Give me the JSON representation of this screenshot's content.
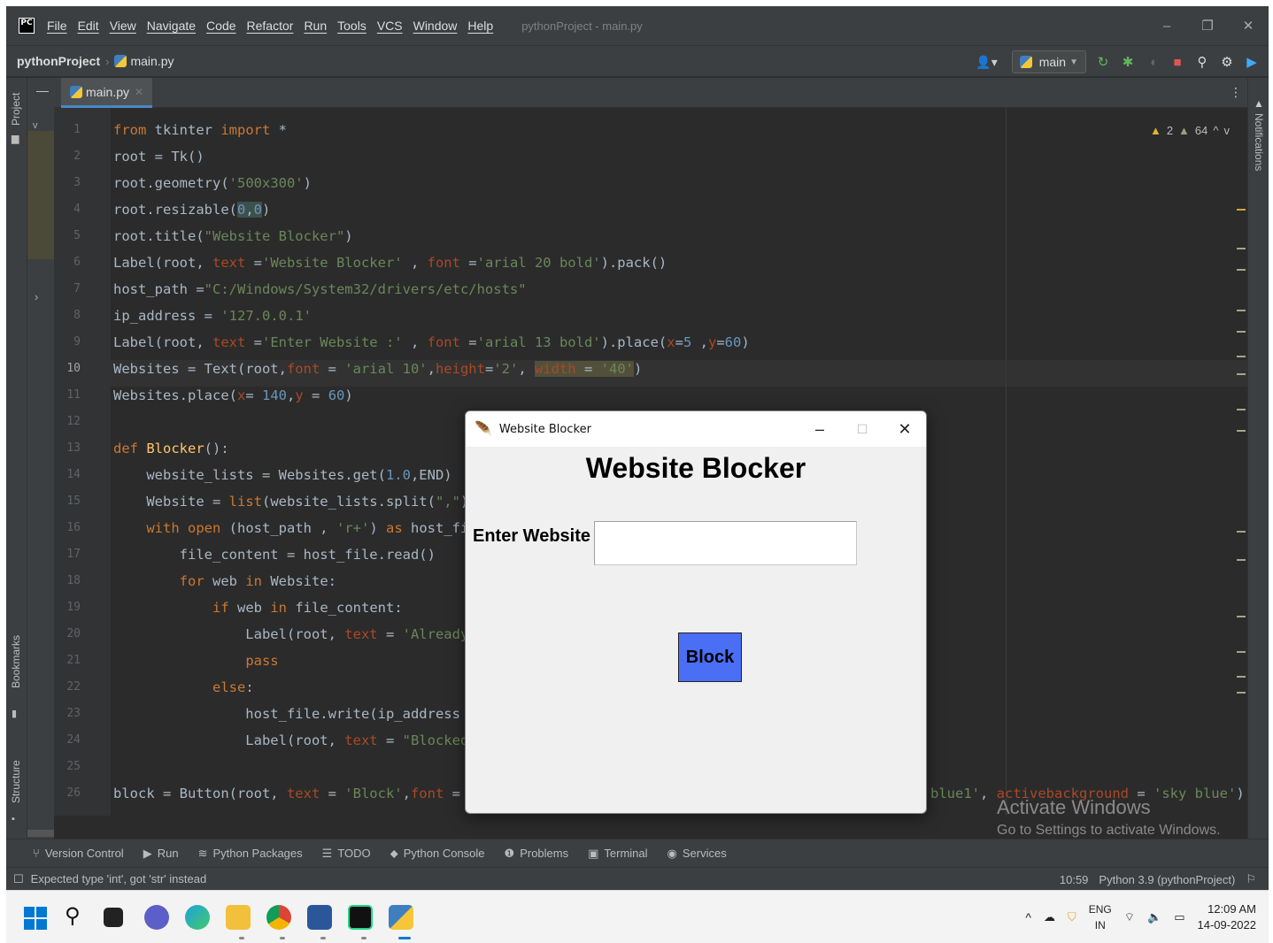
{
  "ide": {
    "menu": [
      "File",
      "Edit",
      "View",
      "Navigate",
      "Code",
      "Refactor",
      "Run",
      "Tools",
      "VCS",
      "Window",
      "Help"
    ],
    "window_title": "pythonProject - main.py",
    "breadcrumb": {
      "project": "pythonProject",
      "file": "main.py"
    },
    "run_config": "main",
    "tab": {
      "label": "main.py"
    },
    "left_panels": {
      "project": "Project",
      "bookmarks": "Bookmarks",
      "structure": "Structure"
    },
    "right_panels": {
      "notifications": "Notifications"
    },
    "inspections": {
      "warnings": "2",
      "weak_warnings": "64"
    },
    "line_numbers": [
      "1",
      "2",
      "3",
      "4",
      "5",
      "6",
      "7",
      "8",
      "9",
      "10",
      "11",
      "12",
      "13",
      "14",
      "15",
      "16",
      "17",
      "18",
      "19",
      "20",
      "21",
      "22",
      "23",
      "24",
      "25",
      "26"
    ],
    "tool_windows": [
      "Version Control",
      "Run",
      "Python Packages",
      "TODO",
      "Python Console",
      "Problems",
      "Terminal",
      "Services"
    ],
    "status": {
      "message": "Expected type 'int', got 'str' instead",
      "position": "10:59",
      "interpreter": "Python 3.9 (pythonProject)"
    },
    "activate_windows": {
      "title": "Activate Windows",
      "subtitle": "Go to Settings to activate Windows."
    }
  },
  "taskbar": {
    "language": "ENG",
    "region": "IN",
    "time": "12:09 AM",
    "date": "14-09-2022"
  },
  "tk_app": {
    "window_title": "Website Blocker",
    "heading": "Website Blocker",
    "label": "Enter Website :",
    "entry_value": "",
    "button_label": "Block",
    "button_color": "#4a6ff5"
  },
  "colors": {
    "ide_bg": "#2b2b2b",
    "keyword": "#cc7832",
    "string": "#6a8759",
    "number": "#6897bb"
  }
}
